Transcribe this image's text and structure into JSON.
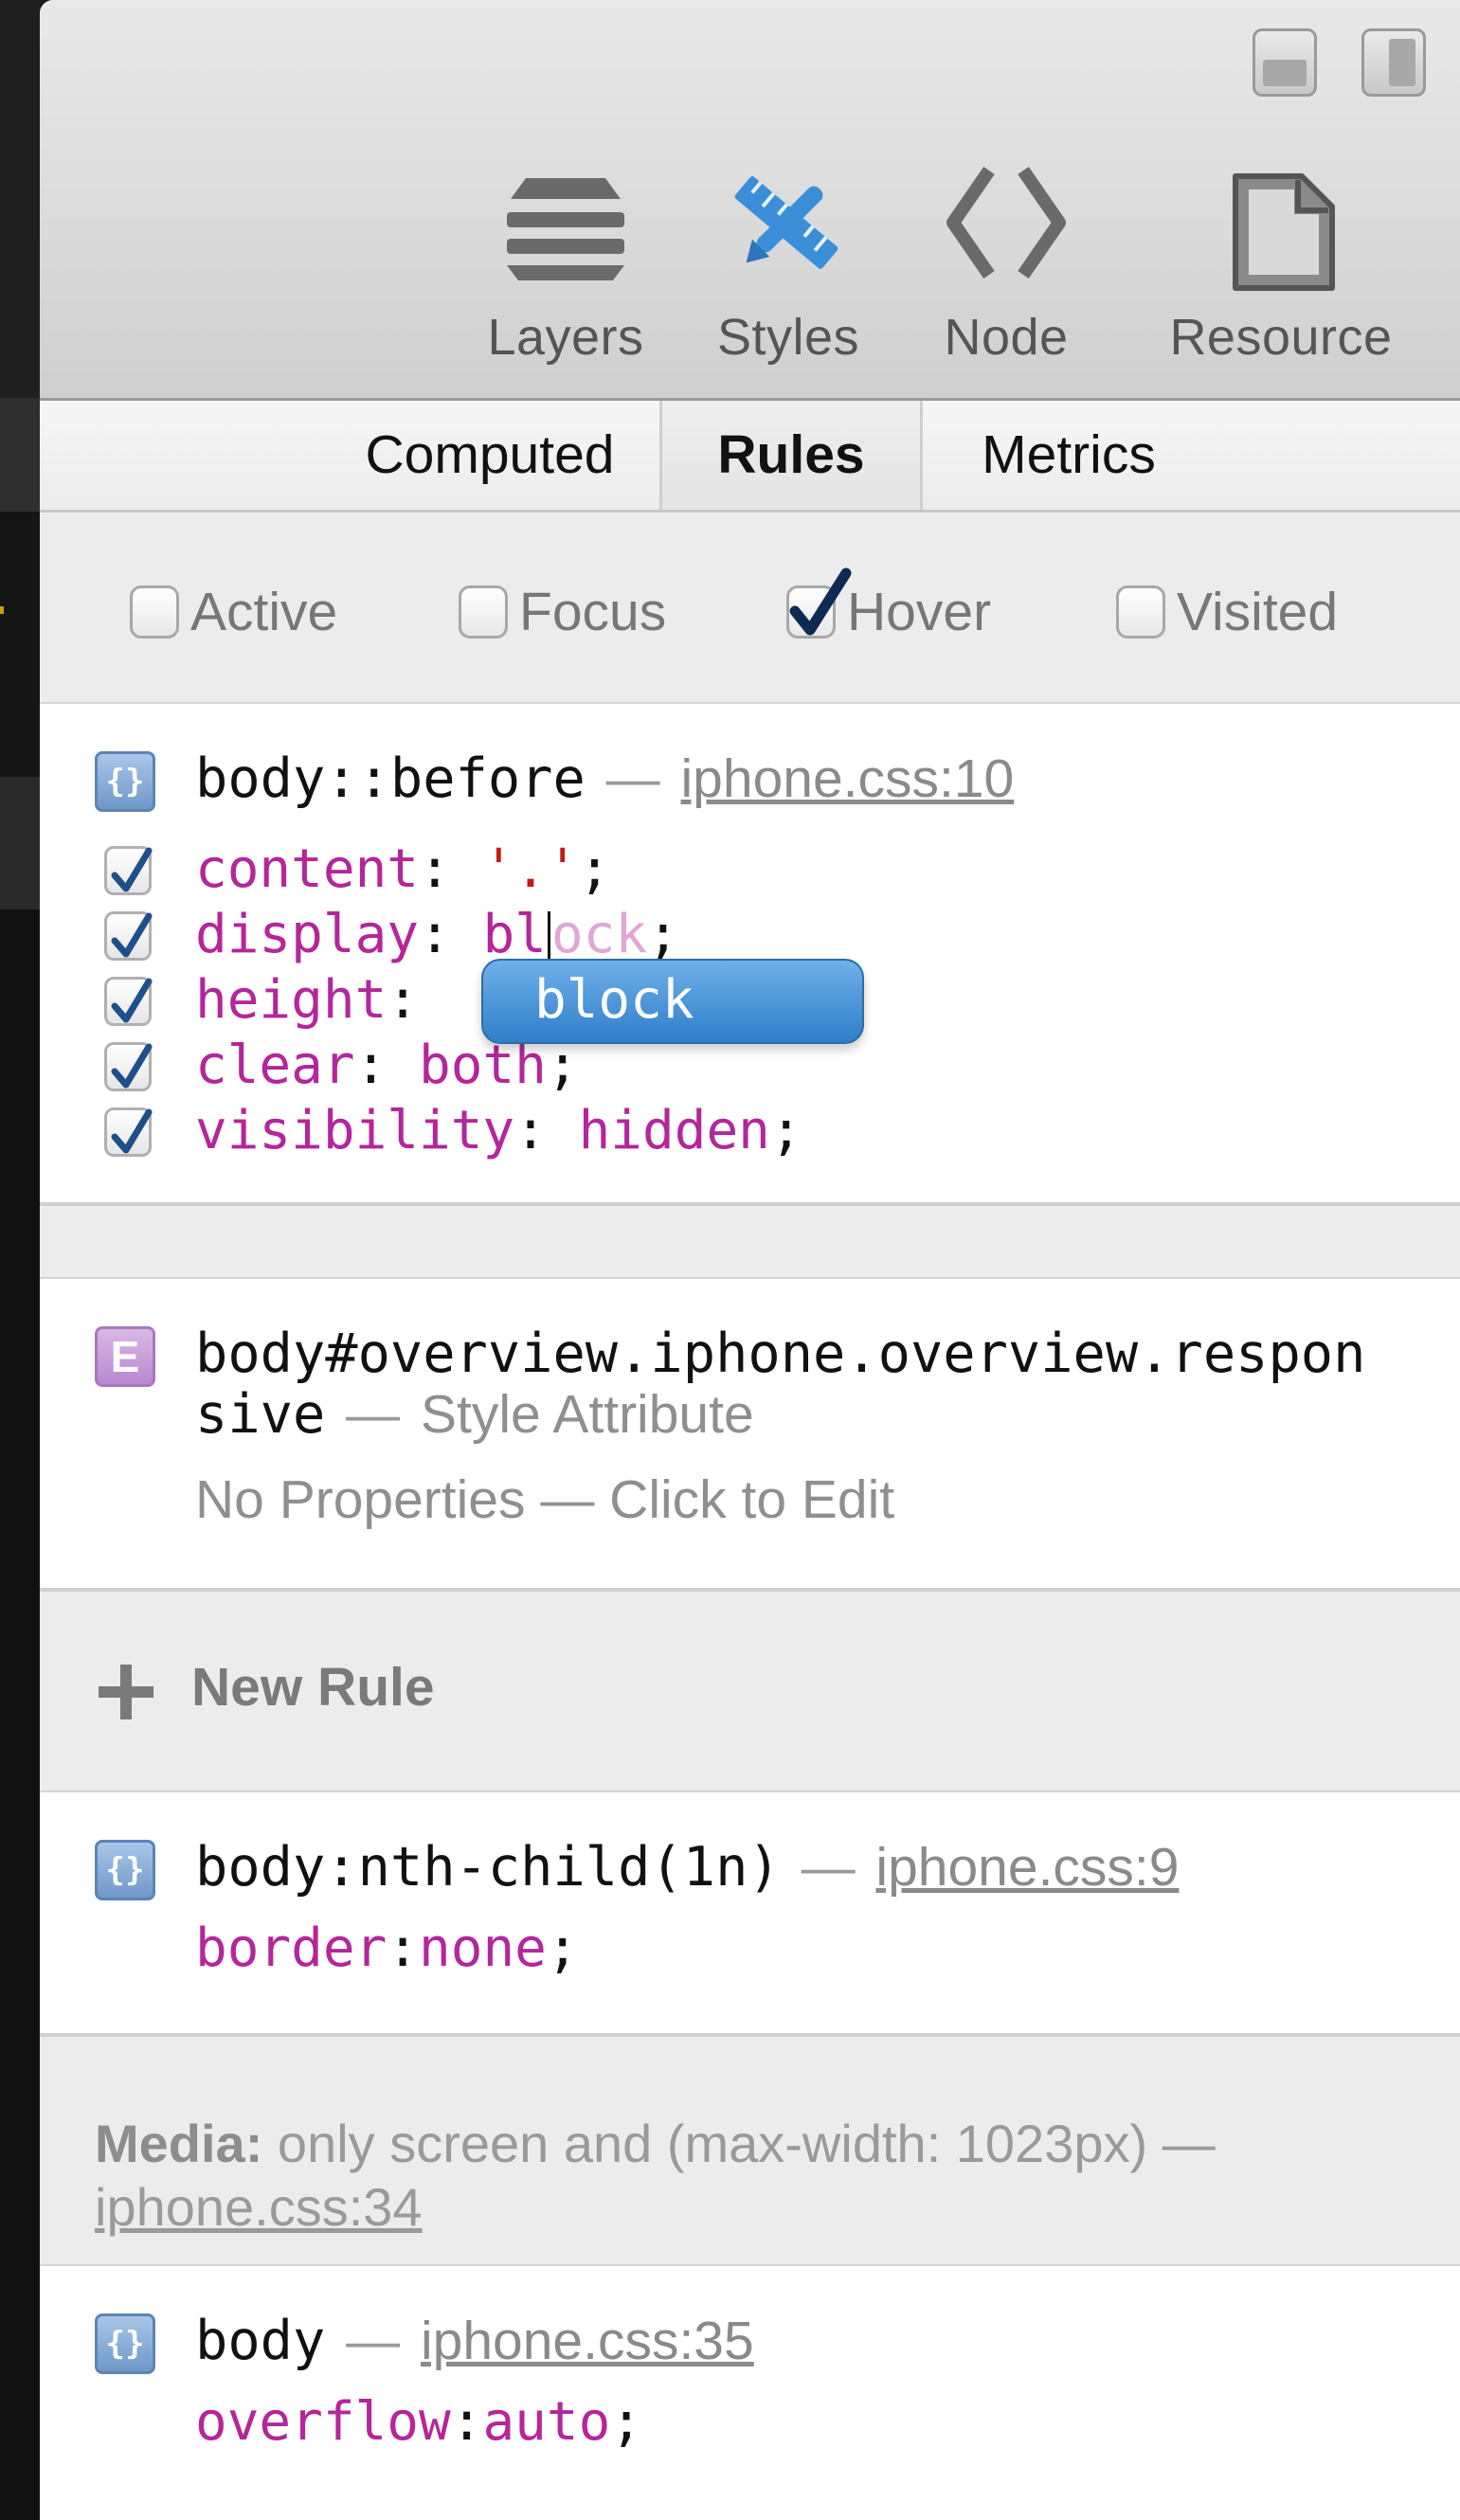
{
  "toolbar": {
    "tools": [
      {
        "label": "Layers",
        "icon": "layers-icon"
      },
      {
        "label": "Styles",
        "icon": "styles-icon",
        "active": true
      },
      {
        "label": "Node",
        "icon": "node-icon"
      },
      {
        "label": "Resource",
        "icon": "resource-icon"
      }
    ]
  },
  "tabs": [
    {
      "label": "Computed"
    },
    {
      "label": "Rules",
      "selected": true
    },
    {
      "label": "Metrics"
    }
  ],
  "pseudo_classes": [
    {
      "label": "Active",
      "checked": false
    },
    {
      "label": "Focus",
      "checked": false
    },
    {
      "label": "Hover",
      "checked": true
    },
    {
      "label": "Visited",
      "checked": false
    }
  ],
  "rule1": {
    "selector": "body::before",
    "dash": "—",
    "source": "iphone.css:10",
    "properties": [
      {
        "name": "content",
        "colon": ": ",
        "value": "'.'",
        "semi": ";"
      },
      {
        "name": "display",
        "colon": ": ",
        "value_typed": "bl",
        "value_ghost": "ock",
        "semi": ";"
      },
      {
        "name": "height",
        "colon": ":",
        "value": "",
        "semi": ""
      },
      {
        "name": "clear",
        "colon": ": ",
        "value": "both",
        "semi": ";"
      },
      {
        "name": "visibility",
        "colon": ": ",
        "value": "hidden",
        "semi": ";"
      }
    ],
    "autocomplete": "block"
  },
  "rule2": {
    "badge": "E",
    "selector_line1": "body#overview.iphone.overview.respon",
    "selector_line2": "sive",
    "dash": "—",
    "source": "Style Attribute",
    "empty": "No Properties — Click to Edit"
  },
  "new_rule": "New Rule",
  "rule3": {
    "selector": "body:nth-child(1n)",
    "dash": "—",
    "source": "iphone.css:9",
    "prop_name": "border",
    "prop_value": "none",
    "punct_colon": ":",
    "punct_semi": ";"
  },
  "media": {
    "label": "Media:",
    "query": "only screen and (max-width: 1023px) —",
    "source": "iphone.css:34"
  },
  "rule4": {
    "selector": "body",
    "dash": "—",
    "source": "iphone.css:35",
    "prop_name": "overflow",
    "prop_value": "auto",
    "punct_colon": ":",
    "punct_semi": ";"
  },
  "colors": {
    "property": "#b5259b",
    "string": "#c41a16",
    "accent": "#3b8fd8",
    "autocomplete": "#3a86cf"
  }
}
